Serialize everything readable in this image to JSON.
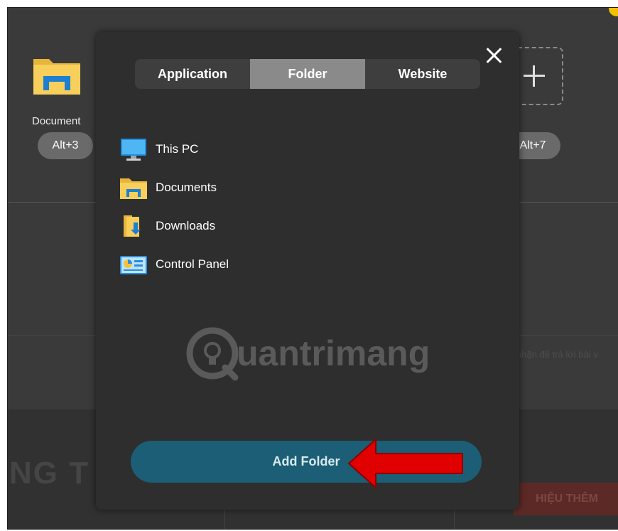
{
  "background": {
    "apps": [
      {
        "label": "Document",
        "shortcut": "Alt+3"
      },
      {
        "label": "",
        "shortcut": "Alt+7"
      }
    ],
    "hint_text": "nhận để trả lời bài v",
    "banner_text": "NG T",
    "banner_button": "HIỆU THÊM"
  },
  "modal": {
    "tabs": [
      {
        "label": "Application",
        "active": false
      },
      {
        "label": "Folder",
        "active": true
      },
      {
        "label": "Website",
        "active": false
      }
    ],
    "folders": [
      {
        "label": "This PC",
        "icon": "monitor-icon"
      },
      {
        "label": "Documents",
        "icon": "documents-folder-icon"
      },
      {
        "label": "Downloads",
        "icon": "downloads-folder-icon"
      },
      {
        "label": "Control Panel",
        "icon": "control-panel-icon"
      }
    ],
    "watermark": "uantrimang",
    "add_button": "Add Folder"
  },
  "colors": {
    "modal_bg": "#2e2e2e",
    "active_tab": "#8a8a8a",
    "add_button": "#1b5e75",
    "arrow": "#e00000"
  }
}
